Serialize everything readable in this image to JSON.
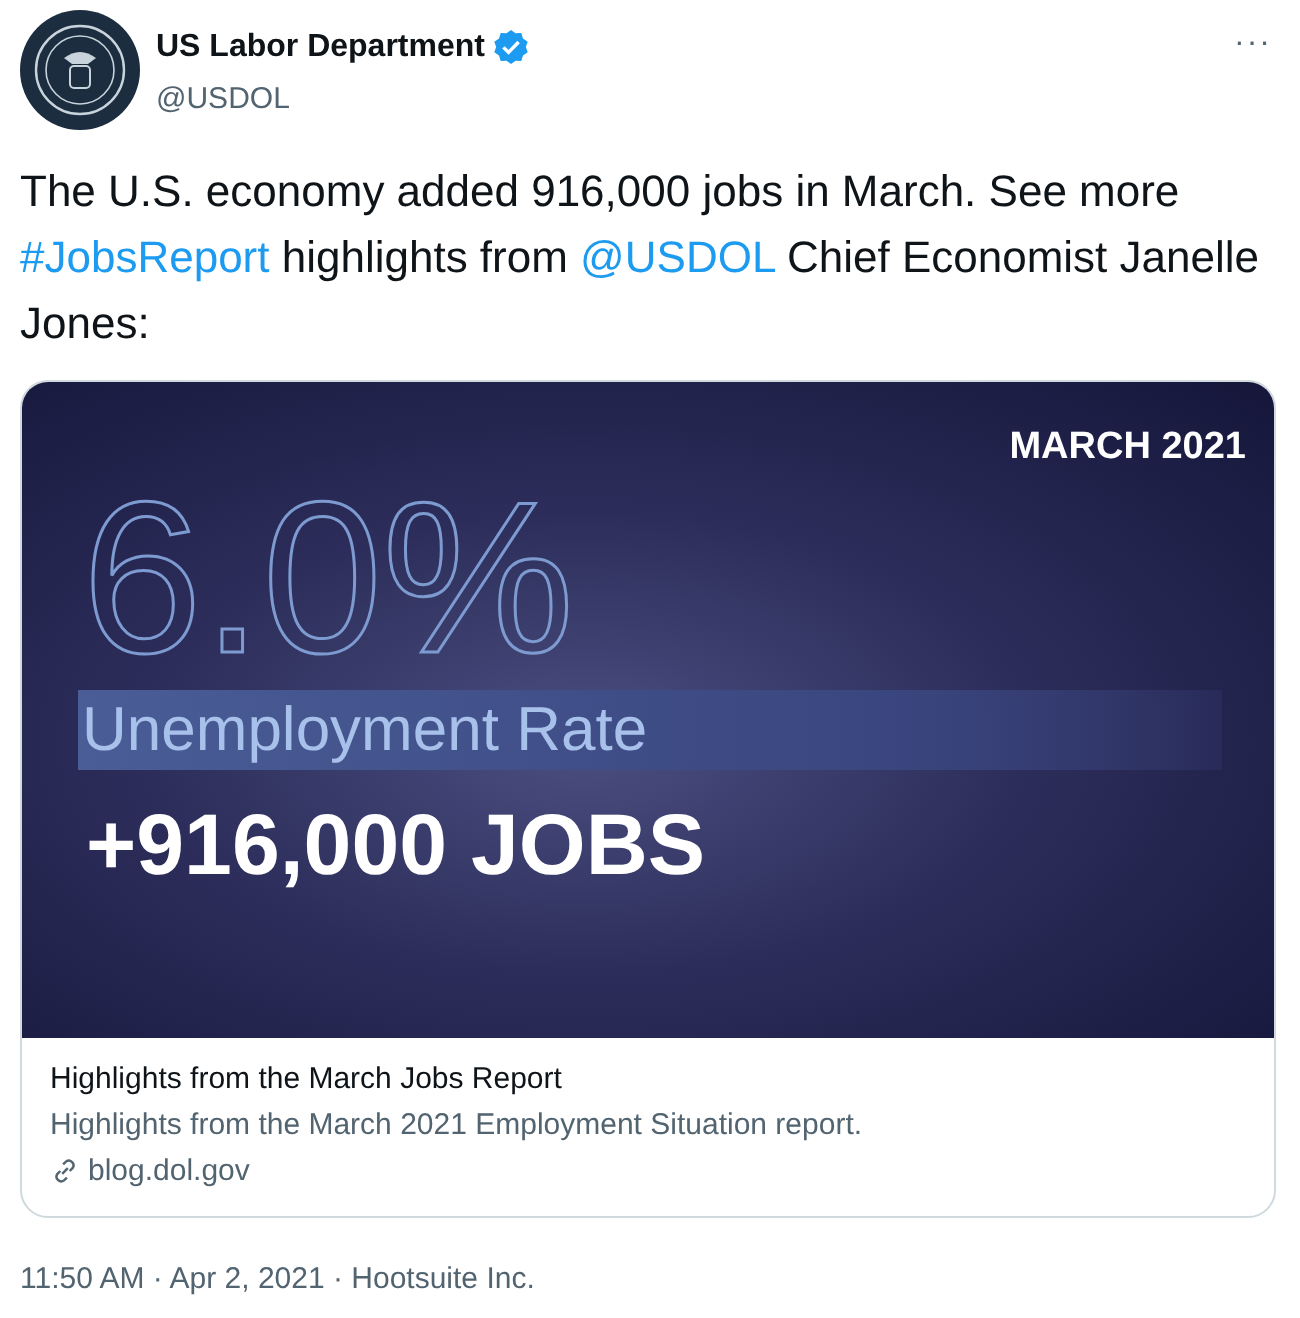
{
  "author": {
    "name": "US Labor Department",
    "verified": true,
    "handle": "@USDOL"
  },
  "more_button": "···",
  "body": [
    {
      "kind": "text",
      "text": "The U.S. economy added 916,000 jobs in March. See more "
    },
    {
      "kind": "link",
      "text": "#JobsReport"
    },
    {
      "kind": "text",
      "text": " highlights from "
    },
    {
      "kind": "link",
      "text": "@USDOL"
    },
    {
      "kind": "text",
      "text": " Chief Economist Janelle Jones:"
    }
  ],
  "card": {
    "graphic": {
      "date": "MARCH 2021",
      "rate": "6.0%",
      "rate_label": "Unemployment Rate",
      "jobs": "+916,000 JOBS"
    },
    "title": "Highlights from the March Jobs Report",
    "description": "Highlights from the March 2021 Employment Situation report.",
    "domain": "blog.dol.gov"
  },
  "meta": "11:50 AM · Apr 2, 2021 · Hootsuite Inc."
}
